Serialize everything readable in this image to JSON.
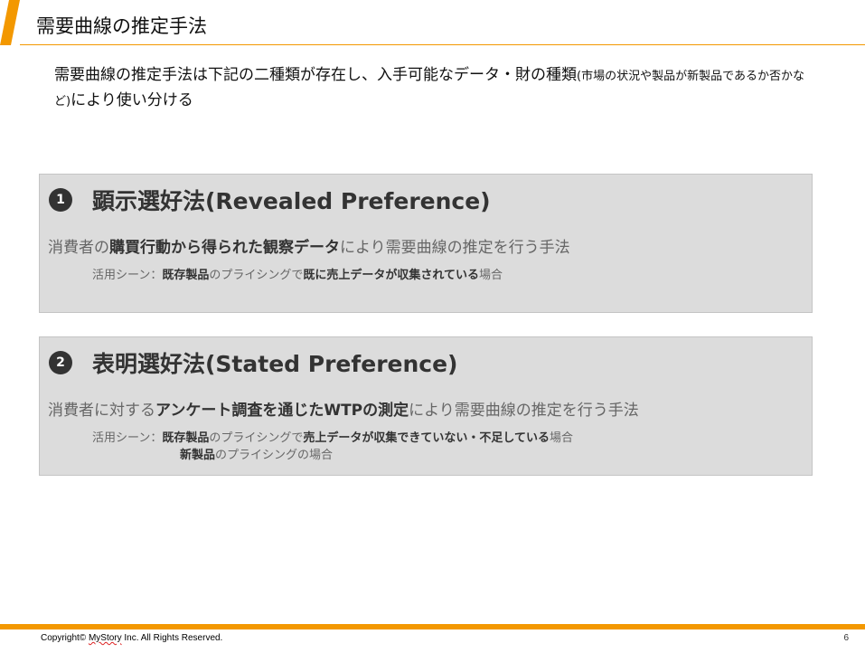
{
  "colors": {
    "accent": "#f39800",
    "badge": "#333333",
    "card_bg": "#dcdcdc"
  },
  "slide": {
    "title": "需要曲線の推定手法",
    "intro_main": "需要曲線の推定手法は下記の二種類が存在し、入手可能なデータ・財の種類",
    "intro_small": "(市場の状況や製品が新製品であるか否かなど)",
    "intro_end": "により使い分ける"
  },
  "methods": [
    {
      "number": "1",
      "title": "顕示選好法(Revealed Preference)",
      "desc": {
        "a": "消費者の",
        "b": "購買行動から得られた観察データ",
        "c": "により需要曲線の推定を行う手法"
      },
      "use": {
        "label": "活用シーン：",
        "a": "既存製品",
        "b": "のプライシングで",
        "c": "既に売上データが収集されている",
        "d": "場合"
      }
    },
    {
      "number": "2",
      "title": "表明選好法(Stated Preference)",
      "desc": {
        "a": "消費者に対する",
        "b": "アンケート調査を通じたWTPの測定",
        "c": "により需要曲線の推定を行う手法"
      },
      "use": {
        "label": "活用シーン：",
        "a": "既存製品",
        "b": "のプライシングで",
        "c": "売上データが収集できていない・不足している",
        "d": "場合",
        "e": "新製品",
        "f": "のプライシングの場合"
      }
    }
  ],
  "footer": {
    "copyright_prefix": "Copyright© ",
    "company": "MyStory",
    "copyright_suffix": " Inc. All Rights Reserved.",
    "page": "6"
  }
}
